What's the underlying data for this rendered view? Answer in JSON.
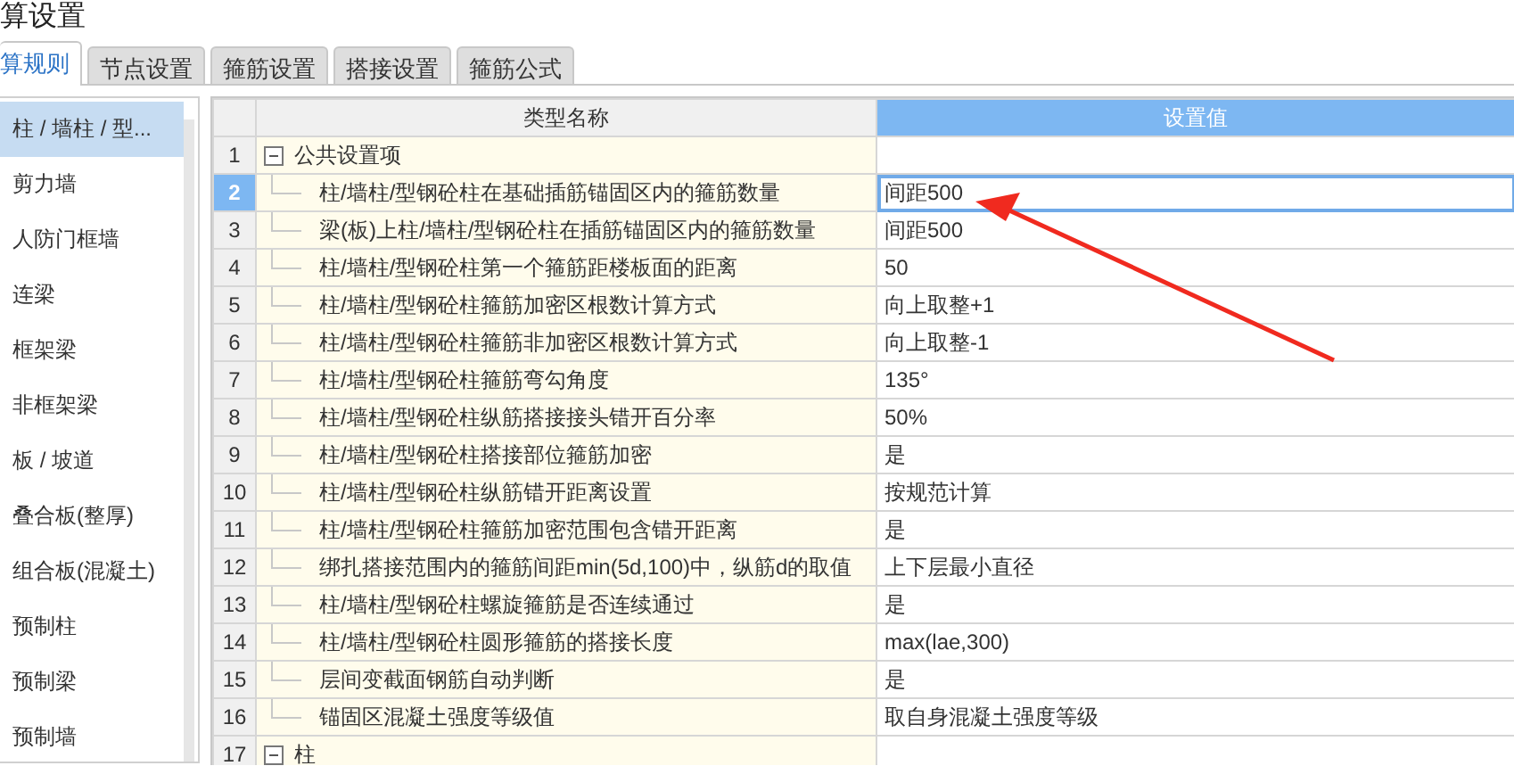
{
  "window": {
    "title": "算设置"
  },
  "tabs": [
    {
      "label": "算规则",
      "selected": true
    },
    {
      "label": "节点设置",
      "selected": false
    },
    {
      "label": "箍筋设置",
      "selected": false
    },
    {
      "label": "搭接设置",
      "selected": false
    },
    {
      "label": "箍筋公式",
      "selected": false
    }
  ],
  "sidebar": {
    "items": [
      {
        "label": "柱 / 墙柱 / 型...",
        "selected": true
      },
      {
        "label": "剪力墙",
        "selected": false
      },
      {
        "label": "人防门框墙",
        "selected": false
      },
      {
        "label": "连梁",
        "selected": false
      },
      {
        "label": "框架梁",
        "selected": false
      },
      {
        "label": "非框架梁",
        "selected": false
      },
      {
        "label": "板 / 坡道",
        "selected": false
      },
      {
        "label": "叠合板(整厚)",
        "selected": false
      },
      {
        "label": "组合板(混凝土)",
        "selected": false
      },
      {
        "label": "预制柱",
        "selected": false
      },
      {
        "label": "预制梁",
        "selected": false
      },
      {
        "label": "预制墙",
        "selected": false
      }
    ]
  },
  "table": {
    "columns": [
      "类型名称",
      "设置值"
    ],
    "groups": [
      {
        "number": "1",
        "label": "公共设置项",
        "expanded": true,
        "rows": [
          {
            "number": "2",
            "name": "柱/墙柱/型钢砼柱在基础插筋锚固区内的箍筋数量",
            "value": "间距500",
            "selected": true
          },
          {
            "number": "3",
            "name": "梁(板)上柱/墙柱/型钢砼柱在插筋锚固区内的箍筋数量",
            "value": "间距500",
            "selected": false
          },
          {
            "number": "4",
            "name": "柱/墙柱/型钢砼柱第一个箍筋距楼板面的距离",
            "value": "50",
            "selected": false
          },
          {
            "number": "5",
            "name": "柱/墙柱/型钢砼柱箍筋加密区根数计算方式",
            "value": "向上取整+1",
            "selected": false
          },
          {
            "number": "6",
            "name": "柱/墙柱/型钢砼柱箍筋非加密区根数计算方式",
            "value": "向上取整-1",
            "selected": false
          },
          {
            "number": "7",
            "name": "柱/墙柱/型钢砼柱箍筋弯勾角度",
            "value": "135°",
            "selected": false
          },
          {
            "number": "8",
            "name": "柱/墙柱/型钢砼柱纵筋搭接接头错开百分率",
            "value": "50%",
            "selected": false
          },
          {
            "number": "9",
            "name": "柱/墙柱/型钢砼柱搭接部位箍筋加密",
            "value": "是",
            "selected": false
          },
          {
            "number": "10",
            "name": "柱/墙柱/型钢砼柱纵筋错开距离设置",
            "value": "按规范计算",
            "selected": false
          },
          {
            "number": "11",
            "name": "柱/墙柱/型钢砼柱箍筋加密范围包含错开距离",
            "value": "是",
            "selected": false
          },
          {
            "number": "12",
            "name": "绑扎搭接范围内的箍筋间距min(5d,100)中，纵筋d的取值",
            "value": "上下层最小直径",
            "selected": false
          },
          {
            "number": "13",
            "name": "柱/墙柱/型钢砼柱螺旋箍筋是否连续通过",
            "value": "是",
            "selected": false
          },
          {
            "number": "14",
            "name": "柱/墙柱/型钢砼柱圆形箍筋的搭接长度",
            "value": "max(lae,300)",
            "selected": false
          },
          {
            "number": "15",
            "name": "层间变截面钢筋自动判断",
            "value": "是",
            "selected": false
          },
          {
            "number": "16",
            "name": "锚固区混凝土强度等级值",
            "value": "取自身混凝土强度等级",
            "selected": false
          }
        ]
      },
      {
        "number": "17",
        "label": "柱",
        "expanded": true
      }
    ]
  }
}
